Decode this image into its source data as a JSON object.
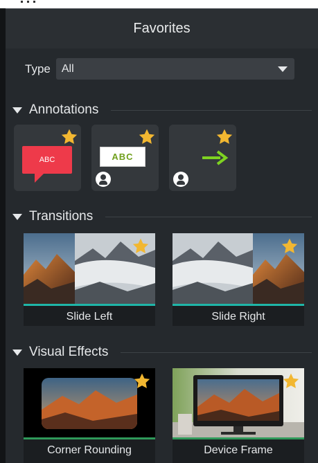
{
  "panel": {
    "title": "Favorites"
  },
  "filter": {
    "label": "Type",
    "value": "All"
  },
  "sections": {
    "annotations": {
      "title": "Annotations",
      "items": [
        {
          "name": "speech-bubble",
          "text": "ABC",
          "favorite": true,
          "user_made": false
        },
        {
          "name": "text-box",
          "text": "ABC",
          "favorite": true,
          "user_made": true
        },
        {
          "name": "arrow",
          "favorite": true,
          "user_made": true
        }
      ]
    },
    "transitions": {
      "title": "Transitions",
      "items": [
        {
          "label": "Slide Left",
          "favorite": true
        },
        {
          "label": "Slide Right",
          "favorite": true
        }
      ]
    },
    "visual_effects": {
      "title": "Visual Effects",
      "items": [
        {
          "label": "Corner Rounding",
          "favorite": true
        },
        {
          "label": "Device Frame",
          "favorite": true
        }
      ]
    }
  },
  "colors": {
    "star": "#f2b731",
    "transition_bar": "#1fb6a8",
    "effect_bar": "#2f9a5a",
    "bubble": "#ee3a4a",
    "arrow": "#7ed321"
  }
}
